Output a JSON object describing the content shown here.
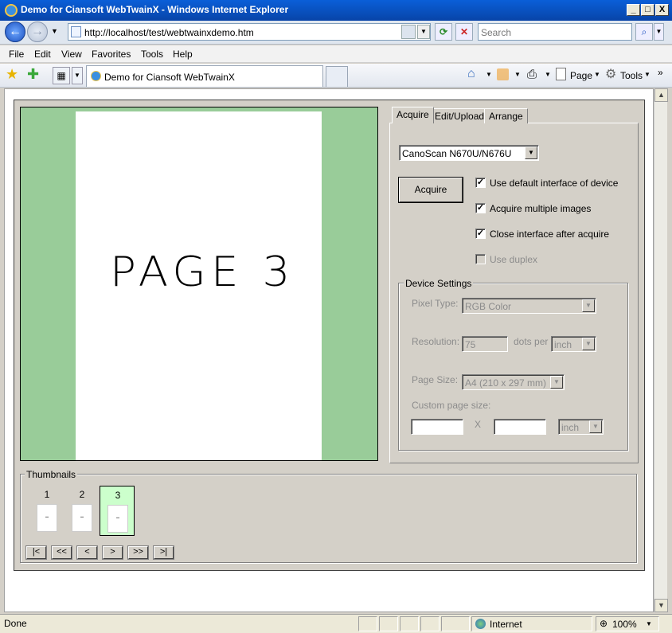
{
  "window": {
    "title": "Demo for Ciansoft WebTwainX - Windows Internet Explorer",
    "min_glyph": "_",
    "max_glyph": "□",
    "close_glyph": "X"
  },
  "address_bar": {
    "url": "http://localhost/test/webtwainxdemo.htm",
    "search_placeholder": "Search"
  },
  "menu": [
    "File",
    "Edit",
    "View",
    "Favorites",
    "Tools",
    "Help"
  ],
  "browser_tab": {
    "title": "Demo for Ciansoft WebTwainX"
  },
  "toolbar": {
    "page_label": "Page",
    "tools_label": "Tools"
  },
  "viewer": {
    "page_text": "PAGE 3"
  },
  "tabs": [
    "Acquire",
    "Edit/Upload",
    "Arrange"
  ],
  "acquire": {
    "device": "CanoScan N670U/N676U",
    "acquire_button": "Acquire",
    "options": [
      {
        "label": "Use default interface of device",
        "checked": true,
        "disabled": false
      },
      {
        "label": "Acquire multiple images",
        "checked": true,
        "disabled": false
      },
      {
        "label": "Close interface after acquire",
        "checked": true,
        "disabled": false
      },
      {
        "label": "Use duplex",
        "checked": false,
        "disabled": true
      }
    ]
  },
  "device_settings": {
    "legend": "Device Settings",
    "pixel_type_label": "Pixel Type:",
    "pixel_type_value": "RGB Color",
    "resolution_label": "Resolution:",
    "resolution_value": "75",
    "dots_per_label": "dots per",
    "resolution_unit": "inch",
    "page_size_label": "Page Size:",
    "page_size_value": "A4 (210 x 297 mm)",
    "custom_size_label": "Custom page size:",
    "custom_x": "X",
    "custom_unit": "inch"
  },
  "thumbnails": {
    "legend": "Thumbnails",
    "items": [
      {
        "num": "1",
        "selected": false
      },
      {
        "num": "2",
        "selected": false
      },
      {
        "num": "3",
        "selected": true
      }
    ],
    "nav": [
      "|<",
      "<<",
      "<",
      ">",
      ">>",
      ">|"
    ]
  },
  "status_bar": {
    "status": "Done",
    "zone": "Internet",
    "zoom": "100%"
  }
}
